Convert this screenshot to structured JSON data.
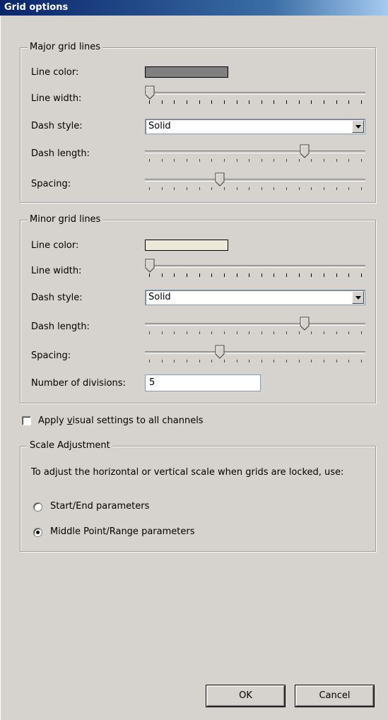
{
  "window": {
    "title": "Grid options"
  },
  "major": {
    "legend": "Major grid lines",
    "line_color_label": "Line color:",
    "line_color": "#808080",
    "line_width_label": "Line width:",
    "line_width_value": 0,
    "dash_style_label": "Dash style:",
    "dash_style_value": "Solid",
    "dash_length_label": "Dash length:",
    "dash_length_value": 0.73,
    "spacing_label": "Spacing:",
    "spacing_value": 0.33
  },
  "minor": {
    "legend": "Minor grid lines",
    "line_color_label": "Line color:",
    "line_color": "#ece9d8",
    "line_width_label": "Line width:",
    "line_width_value": 0,
    "dash_style_label": "Dash style:",
    "dash_style_value": "Solid",
    "dash_length_label": "Dash length:",
    "dash_length_value": 0.73,
    "spacing_label": "Spacing:",
    "spacing_value": 0.33,
    "divisions_label": "Number of divisions:",
    "divisions_value": "5"
  },
  "apply_all": {
    "label_pre": "Apply ",
    "label_u": "v",
    "label_post": "isual settings to all channels",
    "checked": false
  },
  "scale": {
    "legend": "Scale Adjustment",
    "description": "To adjust the horizontal or vertical scale when grids are locked, use:",
    "options": [
      {
        "label": "Start/End parameters",
        "selected": false
      },
      {
        "label": "Middle Point/Range parameters",
        "selected": true
      }
    ]
  },
  "buttons": {
    "ok": "OK",
    "cancel": "Cancel"
  }
}
